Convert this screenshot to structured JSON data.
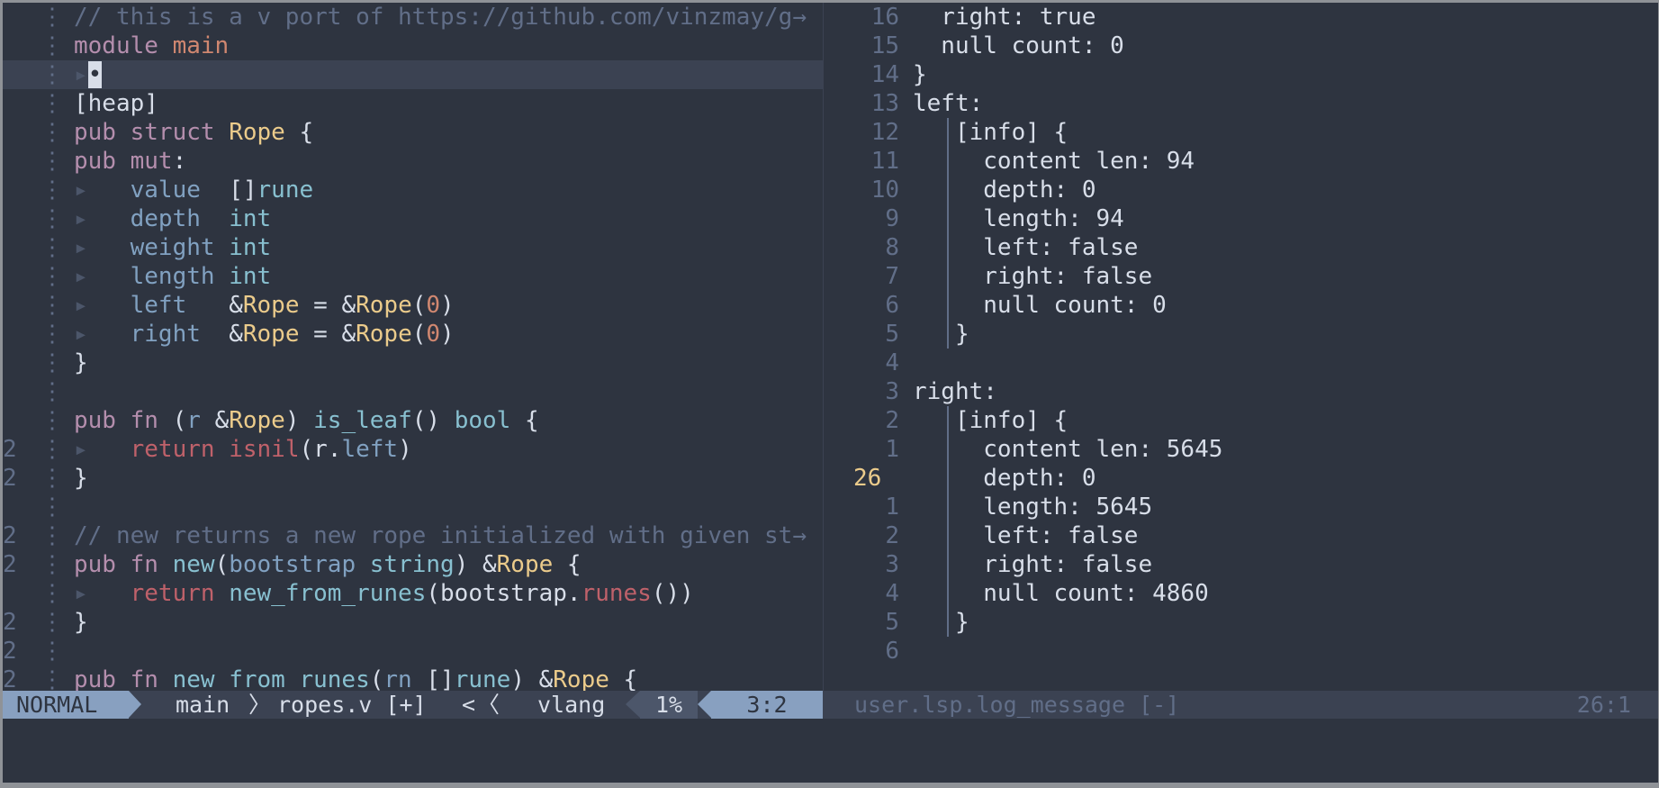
{
  "editor": {
    "left": {
      "lines": [
        {
          "num": "",
          "segs": [
            {
              "t": "// this is a v port of https://github.com/vinzmay/g→",
              "c": "k-comment"
            }
          ]
        },
        {
          "num": "",
          "segs": [
            {
              "t": "module ",
              "c": "k-kw"
            },
            {
              "t": "main",
              "c": "k-mod"
            }
          ]
        },
        {
          "num": "",
          "cursor": true,
          "segs": [
            {
              "t": "▸",
              "c": "k-indent"
            },
            {
              "t": "•",
              "c": "cursor"
            }
          ]
        },
        {
          "num": "",
          "segs": [
            {
              "t": "[heap]",
              "c": "k-plain"
            }
          ]
        },
        {
          "num": "",
          "segs": [
            {
              "t": "pub ",
              "c": "k-kw"
            },
            {
              "t": "struct ",
              "c": "k-kw"
            },
            {
              "t": "Rope",
              "c": "k-type"
            },
            {
              "t": " {",
              "c": "k-plain"
            }
          ]
        },
        {
          "num": "",
          "segs": [
            {
              "t": "pub ",
              "c": "k-kw"
            },
            {
              "t": "mut",
              "c": "k-kw"
            },
            {
              "t": ":",
              "c": "k-plain"
            }
          ]
        },
        {
          "num": "",
          "segs": [
            {
              "t": "▸   ",
              "c": "k-indent"
            },
            {
              "t": "value  ",
              "c": "k-field"
            },
            {
              "t": "[]",
              "c": "k-plain"
            },
            {
              "t": "rune",
              "c": "k-fn"
            }
          ]
        },
        {
          "num": "",
          "segs": [
            {
              "t": "▸   ",
              "c": "k-indent"
            },
            {
              "t": "depth  ",
              "c": "k-field"
            },
            {
              "t": "int",
              "c": "k-fn"
            }
          ]
        },
        {
          "num": "",
          "segs": [
            {
              "t": "▸   ",
              "c": "k-indent"
            },
            {
              "t": "weight ",
              "c": "k-field"
            },
            {
              "t": "int",
              "c": "k-fn"
            }
          ]
        },
        {
          "num": "",
          "segs": [
            {
              "t": "▸   ",
              "c": "k-indent"
            },
            {
              "t": "length ",
              "c": "k-field"
            },
            {
              "t": "int",
              "c": "k-fn"
            }
          ]
        },
        {
          "num": "",
          "segs": [
            {
              "t": "▸   ",
              "c": "k-indent"
            },
            {
              "t": "left   ",
              "c": "k-field"
            },
            {
              "t": "&",
              "c": "k-plain"
            },
            {
              "t": "Rope",
              "c": "k-type"
            },
            {
              "t": " = &",
              "c": "k-plain"
            },
            {
              "t": "Rope",
              "c": "k-type"
            },
            {
              "t": "(",
              "c": "k-plain"
            },
            {
              "t": "0",
              "c": "k-num"
            },
            {
              "t": ")",
              "c": "k-plain"
            }
          ]
        },
        {
          "num": "",
          "segs": [
            {
              "t": "▸   ",
              "c": "k-indent"
            },
            {
              "t": "right  ",
              "c": "k-field"
            },
            {
              "t": "&",
              "c": "k-plain"
            },
            {
              "t": "Rope",
              "c": "k-type"
            },
            {
              "t": " = &",
              "c": "k-plain"
            },
            {
              "t": "Rope",
              "c": "k-type"
            },
            {
              "t": "(",
              "c": "k-plain"
            },
            {
              "t": "0",
              "c": "k-num"
            },
            {
              "t": ")",
              "c": "k-plain"
            }
          ]
        },
        {
          "num": "",
          "segs": [
            {
              "t": "}",
              "c": "k-plain"
            }
          ]
        },
        {
          "num": "",
          "segs": []
        },
        {
          "num": "",
          "segs": [
            {
              "t": "pub ",
              "c": "k-kw"
            },
            {
              "t": "fn ",
              "c": "k-kw"
            },
            {
              "t": "(",
              "c": "k-plain"
            },
            {
              "t": "r ",
              "c": "k-field"
            },
            {
              "t": "&",
              "c": "k-plain"
            },
            {
              "t": "Rope",
              "c": "k-type"
            },
            {
              "t": ") ",
              "c": "k-plain"
            },
            {
              "t": "is_leaf",
              "c": "k-fn"
            },
            {
              "t": "() ",
              "c": "k-plain"
            },
            {
              "t": "bool",
              "c": "k-fn"
            },
            {
              "t": " {",
              "c": "k-plain"
            }
          ]
        },
        {
          "num": "2",
          "segs": [
            {
              "t": "▸   ",
              "c": "k-indent"
            },
            {
              "t": "return ",
              "c": "k-ret"
            },
            {
              "t": "isnil",
              "c": "k-ret"
            },
            {
              "t": "(",
              "c": "k-plain"
            },
            {
              "t": "r",
              "c": "k-plain"
            },
            {
              "t": ".",
              "c": "k-plain"
            },
            {
              "t": "left",
              "c": "k-field"
            },
            {
              "t": ")",
              "c": "k-plain"
            }
          ]
        },
        {
          "num": "2",
          "segs": [
            {
              "t": "}",
              "c": "k-plain"
            }
          ]
        },
        {
          "num": "",
          "segs": []
        },
        {
          "num": "2",
          "segs": [
            {
              "t": "// new returns a new rope initialized with given st→",
              "c": "k-comment"
            }
          ]
        },
        {
          "num": "2",
          "segs": [
            {
              "t": "pub ",
              "c": "k-kw"
            },
            {
              "t": "fn ",
              "c": "k-kw"
            },
            {
              "t": "new",
              "c": "k-fn"
            },
            {
              "t": "(",
              "c": "k-plain"
            },
            {
              "t": "bootstrap ",
              "c": "k-field"
            },
            {
              "t": "string",
              "c": "k-fn"
            },
            {
              "t": ") &",
              "c": "k-plain"
            },
            {
              "t": "Rope",
              "c": "k-type"
            },
            {
              "t": " {",
              "c": "k-plain"
            }
          ]
        },
        {
          "num": "",
          "segs": [
            {
              "t": "▸   ",
              "c": "k-indent"
            },
            {
              "t": "return ",
              "c": "k-ret"
            },
            {
              "t": "new_from_runes",
              "c": "k-fn"
            },
            {
              "t": "(",
              "c": "k-plain"
            },
            {
              "t": "bootstrap",
              "c": "k-plain"
            },
            {
              "t": ".",
              "c": "k-plain"
            },
            {
              "t": "runes",
              "c": "k-ret"
            },
            {
              "t": "())",
              "c": "k-plain"
            }
          ]
        },
        {
          "num": "2",
          "segs": [
            {
              "t": "}",
              "c": "k-plain"
            }
          ]
        },
        {
          "num": "2",
          "segs": []
        },
        {
          "num": "2",
          "segs": [
            {
              "t": "pub ",
              "c": "k-kw"
            },
            {
              "t": "fn ",
              "c": "k-kw"
            },
            {
              "t": "new_from_runes",
              "c": "k-fn"
            },
            {
              "t": "(",
              "c": "k-plain"
            },
            {
              "t": "rn ",
              "c": "k-field"
            },
            {
              "t": "[]",
              "c": "k-plain"
            },
            {
              "t": "rune",
              "c": "k-fn"
            },
            {
              "t": ") &",
              "c": "k-plain"
            },
            {
              "t": "Rope",
              "c": "k-type"
            },
            {
              "t": " {",
              "c": "k-plain"
            }
          ]
        }
      ]
    },
    "right": {
      "lines": [
        {
          "num": "16",
          "text": "  right: true",
          "bar": false
        },
        {
          "num": "15",
          "text": "  null count: 0",
          "bar": false
        },
        {
          "num": "14",
          "text": "}",
          "bar": false
        },
        {
          "num": "13",
          "text": "left:",
          "bar": false
        },
        {
          "num": "12",
          "text": "   [info] {",
          "bar": true
        },
        {
          "num": "11",
          "text": "     content len: 94",
          "bar": true
        },
        {
          "num": "10",
          "text": "     depth: 0",
          "bar": true
        },
        {
          "num": "9",
          "text": "     length: 94",
          "bar": true
        },
        {
          "num": "8",
          "text": "     left: false",
          "bar": true
        },
        {
          "num": "7",
          "text": "     right: false",
          "bar": true
        },
        {
          "num": "6",
          "text": "     null count: 0",
          "bar": true
        },
        {
          "num": "5",
          "text": "   }",
          "bar": true
        },
        {
          "num": "4",
          "text": "",
          "bar": false
        },
        {
          "num": "3",
          "text": "right:",
          "bar": false
        },
        {
          "num": "2",
          "text": "   [info] {",
          "bar": true
        },
        {
          "num": "1",
          "text": "     content len: 5645",
          "bar": true
        },
        {
          "num": "26",
          "text": "     depth: 0",
          "bar": true,
          "current": true
        },
        {
          "num": "1",
          "text": "     length: 5645",
          "bar": true
        },
        {
          "num": "2",
          "text": "     left: false",
          "bar": true
        },
        {
          "num": "3",
          "text": "     right: false",
          "bar": true
        },
        {
          "num": "4",
          "text": "     null count: 4860",
          "bar": true
        },
        {
          "num": "5",
          "text": "   }",
          "bar": true
        },
        {
          "num": "6",
          "text": "",
          "bar": false
        }
      ]
    }
  },
  "statusline": {
    "mode": "NORMAL",
    "branch_icon": "git-branch-icon",
    "branch": "main",
    "file": "ropes.v [+]",
    "lsp_glyph": "<",
    "lang_icon": "chip-icon",
    "lang": "vlang",
    "percent": "1%",
    "position": "3:2",
    "right_title": "user.lsp.log_message [-]",
    "right_position": "26:1"
  },
  "colors": {
    "bg": "#2e3440",
    "accent": "#88a0c0",
    "keyword": "#b48ead",
    "type": "#ebcb8b",
    "function": "#88c0d0",
    "comment": "#616e88"
  }
}
